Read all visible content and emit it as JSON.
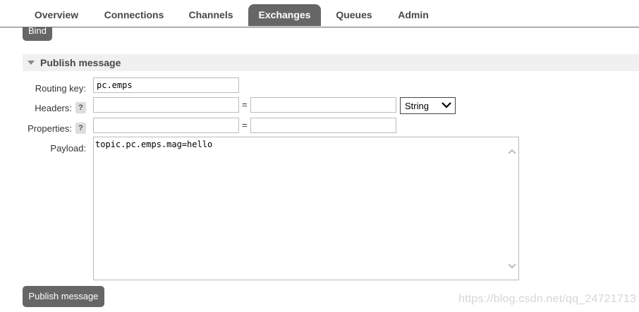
{
  "tabs": {
    "overview": "Overview",
    "connections": "Connections",
    "channels": "Channels",
    "exchanges": "Exchanges",
    "queues": "Queues",
    "admin": "Admin",
    "active": "Exchanges"
  },
  "bind_button": "Bind",
  "publish_section": {
    "title": "Publish message",
    "routing_key_label": "Routing key:",
    "routing_key_value": "pc.emps",
    "headers_label": "Headers:",
    "headers_help": "?",
    "headers_key_value": "",
    "headers_value_value": "",
    "headers_eq": "=",
    "headers_type": "String",
    "properties_label": "Properties:",
    "properties_help": "?",
    "properties_key_value": "",
    "properties_value_value": "",
    "properties_eq": "=",
    "payload_label": "Payload:",
    "payload_value": "topic.pc.emps.mag=hello",
    "publish_button": "Publish message"
  },
  "watermark": "https://blog.csdn.net/qq_24721713",
  "colors": {
    "tab_active_bg": "#666666",
    "button_bg": "#666666",
    "section_bg": "#f0f0f0"
  }
}
